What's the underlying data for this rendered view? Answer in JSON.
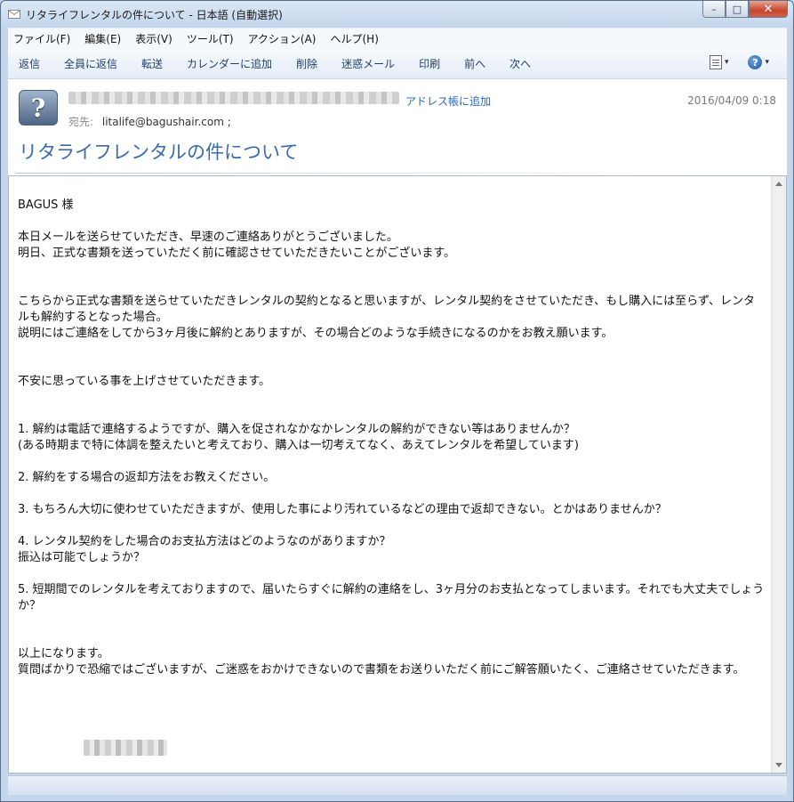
{
  "window": {
    "title": "リタライフレンタルの件について - 日本語 (自動選択)",
    "close_glyph": "✕",
    "maximize_glyph": "□",
    "minimize_glyph": "–"
  },
  "menu": [
    "ファイル(F)",
    "編集(E)",
    "表示(V)",
    "ツール(T)",
    "アクション(A)",
    "ヘルプ(H)"
  ],
  "toolbar": {
    "buttons": [
      "返信",
      "全員に返信",
      "転送",
      "カレンダーに追加",
      "削除",
      "迷惑メール",
      "印刷",
      "前へ",
      "次へ"
    ],
    "dropdown_glyph": "▾",
    "help_glyph": "?"
  },
  "header": {
    "avatar_glyph": "?",
    "add_to_contacts": "アドレス帳に追加",
    "date": "2016/04/09 0:18",
    "to_label": "宛先:",
    "to_value": "litalife@bagushair.com ;",
    "subject": "リタライフレンタルの件について"
  },
  "body": {
    "paragraphs": [
      "BAGUS 様",
      "本日メールを送らせていただき、早速のご連絡ありがとうございました。\n明日、正式な書類を送っていただく前に確認させていただきたいことがございます。",
      "こちらから正式な書類を送らせていただきレンタルの契約となると思いますが、レンタル契約をさせていただき、もし購入には至らず、レンタルも解約するとなった場合。\n説明にはご連絡をしてから3ヶ月後に解約とありますが、その場合どのような手続きになるのかをお教え願います。",
      "不安に思っている事を上げさせていただきます。",
      "1. 解約は電話で連絡するようですが、購入を促されなかなかレンタルの解約ができない等はありませんか？\n(ある時期まで特に体調を整えたいと考えており、購入は一切考えてなく、あえてレンタルを希望しています)",
      "2. 解約をする場合の返却方法をお教えください。",
      "3. もちろん大切に使わせていただきますが、使用した事により汚れているなどの理由で返却できない。とかはありませんか？",
      "4. レンタル契約をした場合のお支払方法はどのようなのがありますか？\n振込は可能でしょうか？",
      "5. 短期間でのレンタルを考えておりますので、届いたらすぐに解約の連絡をし、3ヶ月分のお支払となってしまいます。それでも大丈夫でしょうか？",
      "以上になります。\n質問ばかりで恐縮ではございますが、ご迷惑をおかけできないので書類をお送りいただく前にご解答願いたく、ご連絡させていただきます。"
    ]
  }
}
